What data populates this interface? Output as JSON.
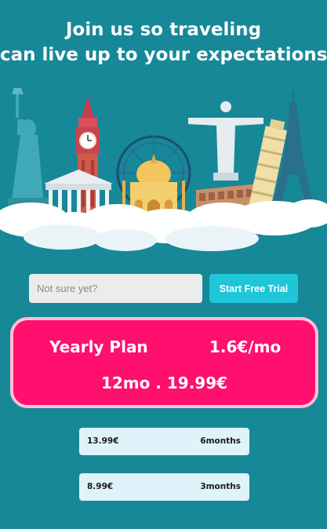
{
  "headline": {
    "line1": "Join us so traveling",
    "line2": "can live up to your expectations!"
  },
  "hero": {
    "illustration": "travel-landmarks-illustration",
    "colors": {
      "background": "#168898",
      "cloud": "#ffffff",
      "statue": "#3fa9b8"
    }
  },
  "signup": {
    "email_placeholder": "Not sure yet?",
    "trial_button_label": "Start Free Trial"
  },
  "plans": {
    "yearly": {
      "name": "Yearly  Plan",
      "monthly_rate": "1.6€/mo",
      "total": "12mo . 19.99€"
    },
    "options": [
      {
        "price": "13.99€",
        "duration": "6months"
      },
      {
        "price": "8.99€",
        "duration": "3months"
      }
    ]
  },
  "colors": {
    "page_background": "#168898",
    "accent_pink": "#ff0f6e",
    "pink_border": "#ffc0d3",
    "cyan_button": "#1ec6d8",
    "option_card": "#dff4fa"
  }
}
